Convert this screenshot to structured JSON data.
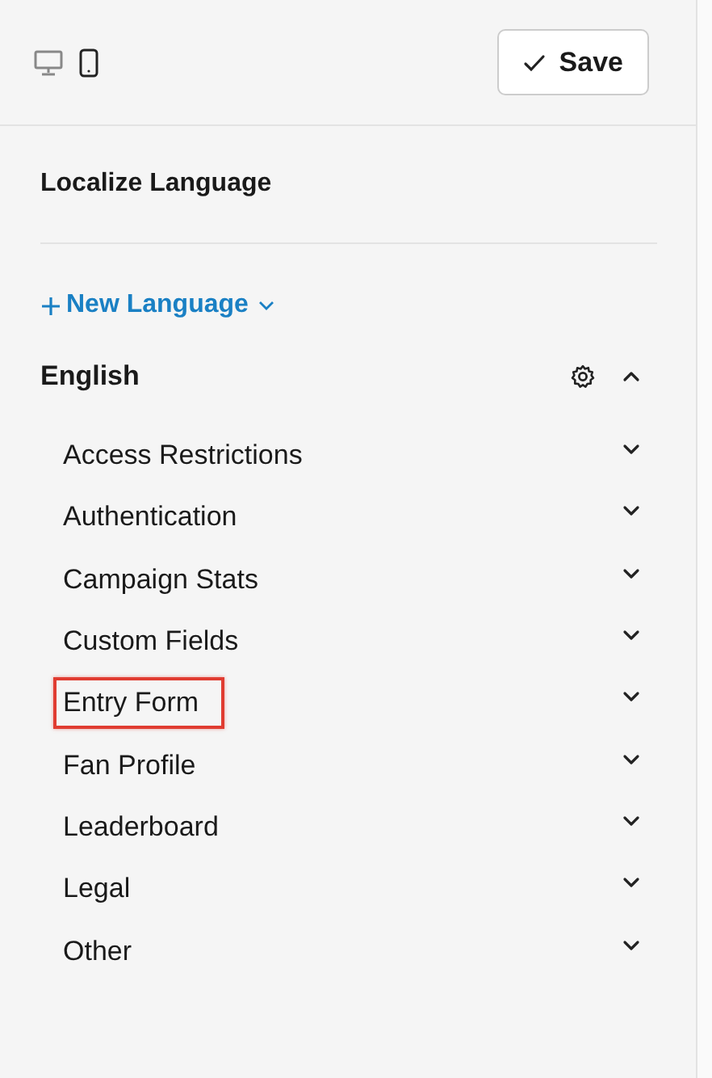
{
  "devices": [
    {
      "kind": "desktop",
      "selected": false
    },
    {
      "kind": "mobile",
      "selected": true
    }
  ],
  "save_button": {
    "label": "Save"
  },
  "section_title": "Localize Language",
  "new_language": {
    "label": "New Language"
  },
  "language": {
    "name": "English",
    "expanded": true,
    "groups": [
      {
        "label": "Access Restrictions",
        "expanded": false,
        "highlighted": false
      },
      {
        "label": "Authentication",
        "expanded": false,
        "highlighted": false
      },
      {
        "label": "Campaign Stats",
        "expanded": false,
        "highlighted": false
      },
      {
        "label": "Custom Fields",
        "expanded": false,
        "highlighted": false
      },
      {
        "label": "Entry Form",
        "expanded": false,
        "highlighted": true
      },
      {
        "label": "Fan Profile",
        "expanded": false,
        "highlighted": false
      },
      {
        "label": "Leaderboard",
        "expanded": false,
        "highlighted": false
      },
      {
        "label": "Legal",
        "expanded": false,
        "highlighted": false
      },
      {
        "label": "Other",
        "expanded": false,
        "highlighted": false
      }
    ]
  }
}
